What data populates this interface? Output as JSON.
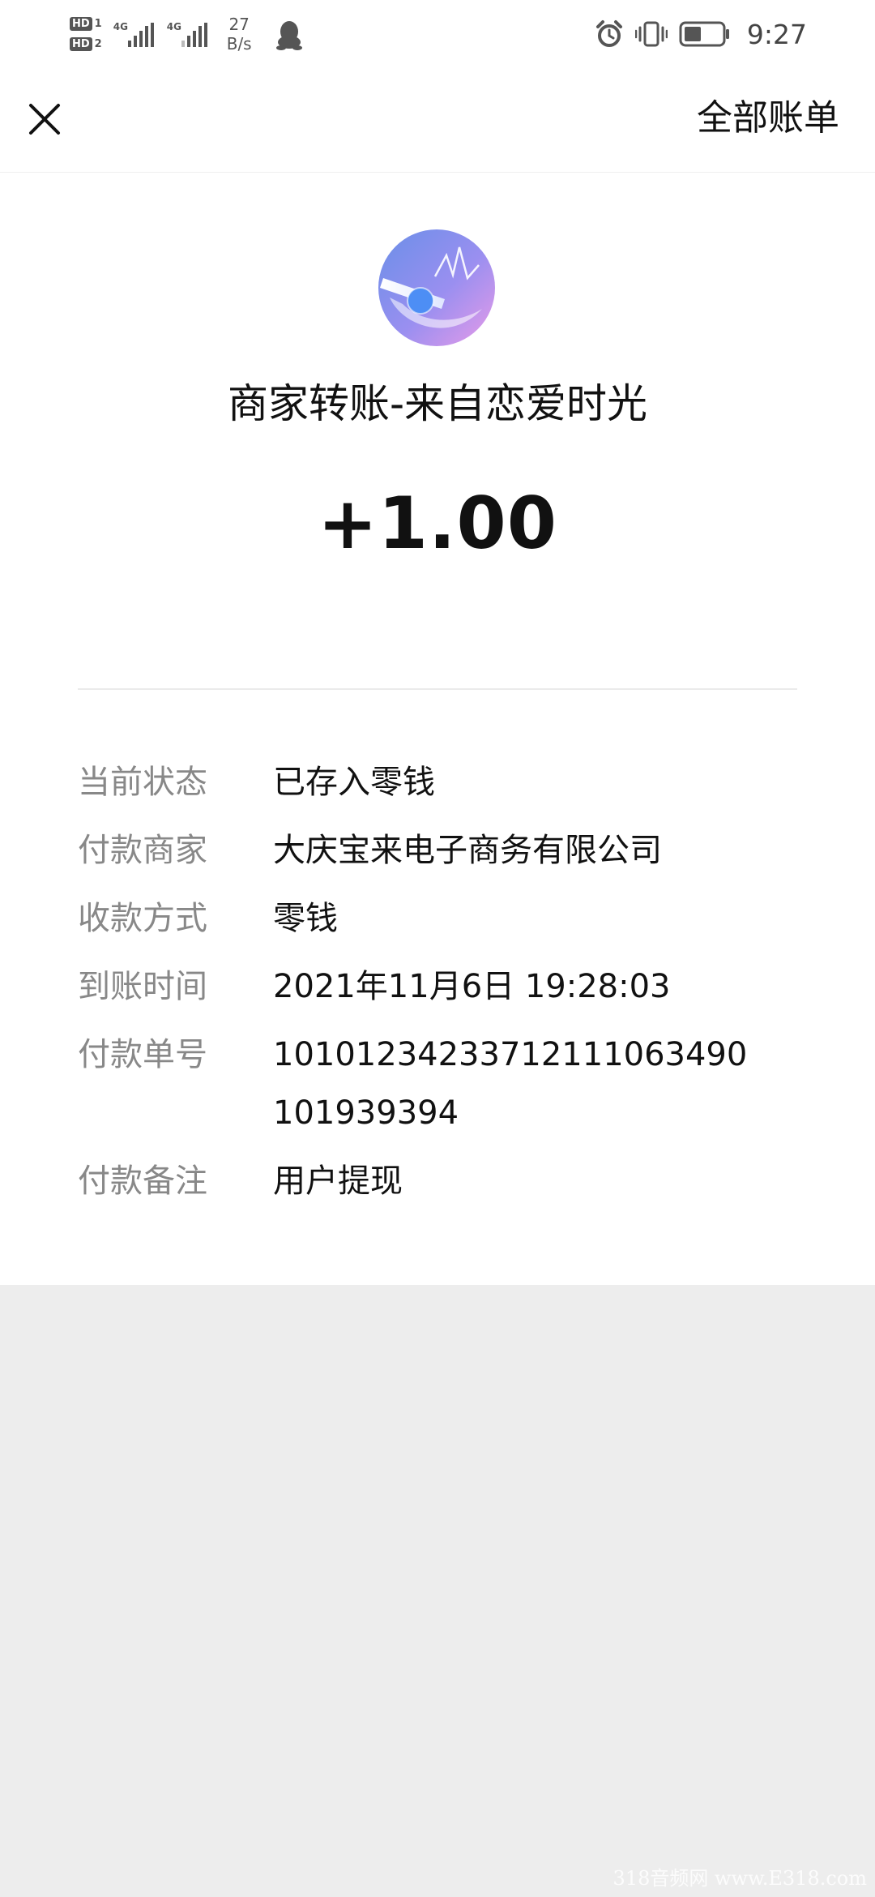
{
  "status_bar": {
    "sim1_badge": "HD",
    "sim1_num": "1",
    "sim2_badge": "HD",
    "sim2_num": "2",
    "network1": "4G",
    "network2": "4G",
    "speed_value": "27",
    "speed_unit": "B/s",
    "time": "9:27",
    "battery_level": 0.45,
    "icons": [
      "qq-icon",
      "alarm-icon",
      "vibrate-icon",
      "battery-icon"
    ]
  },
  "nav": {
    "close_icon": "close-icon",
    "all_bills_label": "全部账单"
  },
  "transaction": {
    "logo_icon": "app-logo",
    "title": "商家转账-来自恋爱时光",
    "amount": "+1.00",
    "details": [
      {
        "label": "当前状态",
        "value": "已存入零钱"
      },
      {
        "label": "付款商家",
        "value": "大庆宝来电子商务有限公司"
      },
      {
        "label": "收款方式",
        "value": "零钱"
      },
      {
        "label": "到账时间",
        "value": "2021年11月6日 19:28:03"
      },
      {
        "label": "付款单号",
        "value": "10101234233712111063490101939394"
      },
      {
        "label": "付款备注",
        "value": "用户提现"
      }
    ]
  },
  "watermark": "318音频网 www.E318.com",
  "colors": {
    "background": "#ededed",
    "card": "#ffffff",
    "label": "#888888",
    "text": "#111111",
    "divider": "#ebebeb"
  }
}
